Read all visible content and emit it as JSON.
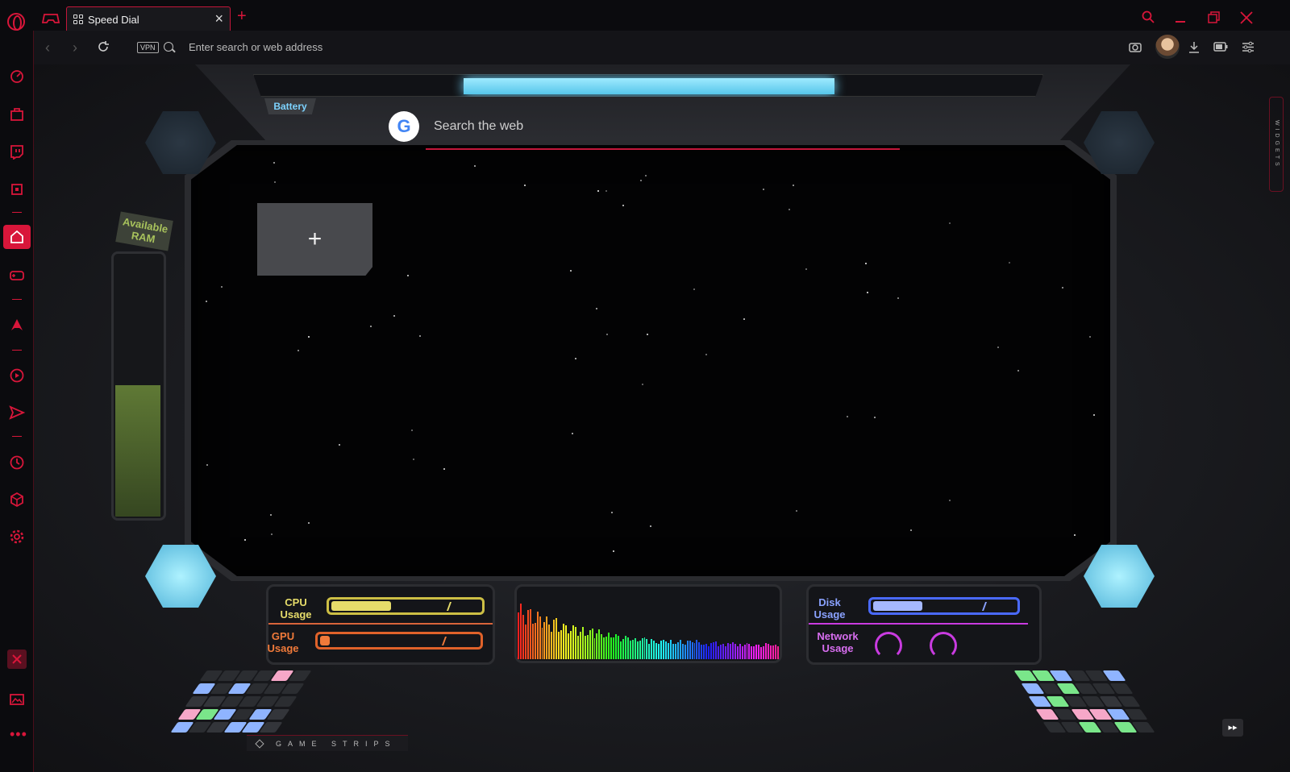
{
  "tabs": [
    {
      "title": "Speed Dial"
    }
  ],
  "address_bar": {
    "placeholder": "Enter search or web address",
    "vpn_label": "VPN"
  },
  "search": {
    "placeholder": "Search the web",
    "engine_logo": "G"
  },
  "widgets": {
    "battery_label": "Battery",
    "ram_label": "Available RAM",
    "ram_level": 0.5,
    "cpu_label": "CPU Usage",
    "gpu_label": "GPU Usage",
    "disk_label": "Disk Usage",
    "network_label": "Network Usage",
    "cpu_level": 0.4,
    "gpu_level": 0.06,
    "disk_level": 0.34,
    "battery_level": 0.47
  },
  "side_panel": {
    "widgets_tab": "WIDGETS"
  },
  "footer": {
    "game_strips": "GAME STRIPS"
  },
  "colors": {
    "accent": "#d8163a",
    "battery": "#74d9ff",
    "cpu": "#e6dc6a",
    "gpu": "#f07a3a",
    "disk": "#6a8aff",
    "network": "#c93be0",
    "ram": "#6c8a3a"
  },
  "icons": [
    "opera-logo-icon",
    "gx-control-icon",
    "speed-dial-icon",
    "add-tab-icon",
    "search-icon",
    "minimize-icon",
    "restore-icon",
    "close-icon",
    "back-icon",
    "forward-icon",
    "reload-icon",
    "snapshot-icon",
    "download-icon",
    "battery-icon",
    "easy-setup-icon",
    "speedometer-icon",
    "shop-icon",
    "twitch-icon",
    "cpu-chip-icon",
    "home-icon",
    "gamepad-icon",
    "gx-corner-icon",
    "player-icon",
    "send-icon",
    "history-icon",
    "extensions-icon",
    "settings-icon",
    "red-x-icon",
    "wallpaper-icon",
    "more-icon",
    "fast-forward-icon"
  ]
}
